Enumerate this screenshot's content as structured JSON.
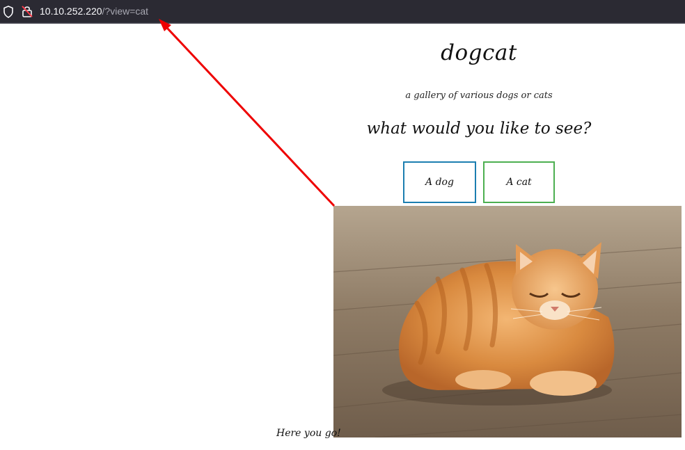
{
  "browser": {
    "url_host": "10.10.252.220",
    "url_path": "/?view=cat"
  },
  "page": {
    "title": "dogcat",
    "tagline": "a gallery of various dogs or cats",
    "question": "what would you like to see?",
    "buttons": {
      "dog": "A dog",
      "cat": "A cat"
    },
    "footer": "Here you go!"
  },
  "colors": {
    "dog_button_border": "#1b7eb0",
    "cat_button_border": "#4caf50",
    "annotation_arrow": "#ee0000"
  },
  "icons": {
    "shield": "shield-icon",
    "lock": "insecure-lock-icon"
  }
}
